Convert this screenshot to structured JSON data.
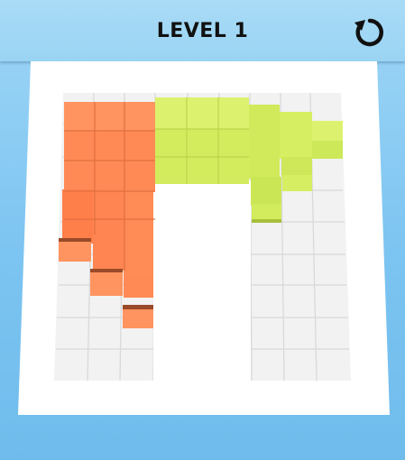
{
  "header": {
    "title": "LEVEL 1",
    "restart_icon": "restart-icon"
  },
  "board": {
    "colors": {
      "orange": "#ff8a55",
      "lime": "#d5ee63",
      "floor": "#f2f2f2",
      "frame": "#ffffff"
    }
  }
}
